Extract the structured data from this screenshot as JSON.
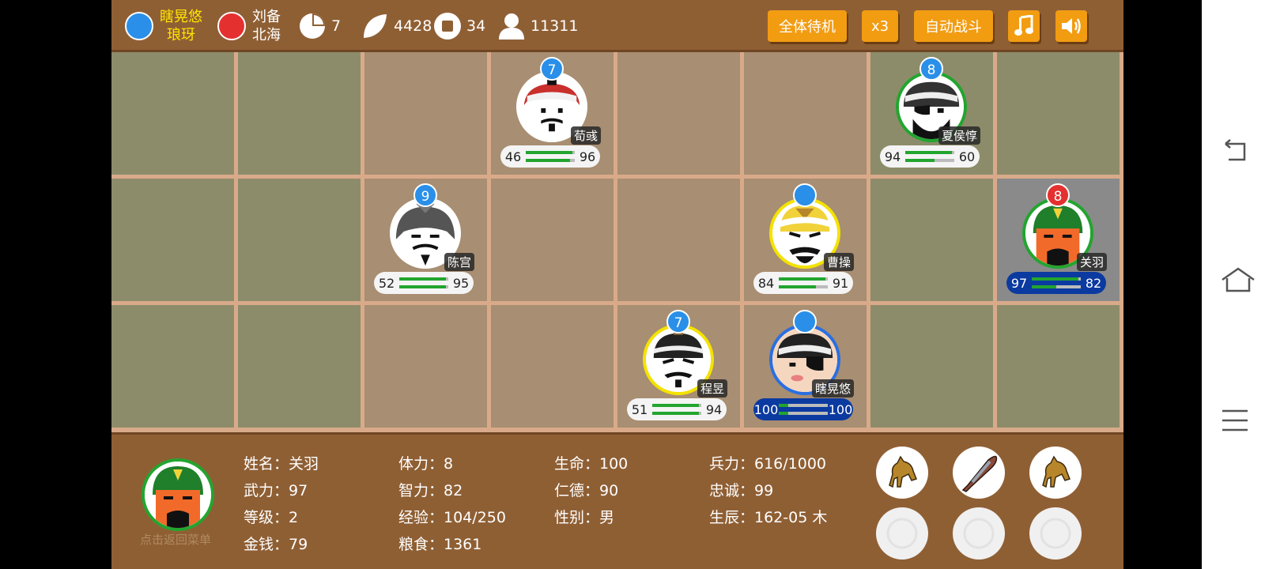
{
  "topbar": {
    "player_faction": {
      "line1": "瞎晃悠",
      "line2": "琅玡",
      "color": "#2a8fe8"
    },
    "enemy_faction": {
      "line1": "刘备",
      "line2": "北海",
      "color": "#e53030"
    },
    "stats": [
      {
        "icon": "pie-chart-icon",
        "value": "7"
      },
      {
        "icon": "leaf-icon",
        "value": "4428"
      },
      {
        "icon": "coin-icon",
        "value": "34"
      },
      {
        "icon": "person-icon",
        "value": "11311"
      }
    ],
    "buttons": {
      "standby": "全体待机",
      "speed": "x3",
      "auto": "自动战斗"
    },
    "music_icon": "music-note-icon",
    "sound_icon": "speaker-icon"
  },
  "units": [
    {
      "name": "荀彧",
      "level": "7",
      "left": "46",
      "right": "96",
      "ring": "#ffffff",
      "badge": "blue",
      "bar": "white",
      "hp": 0.95,
      "mp": 0.9
    },
    {
      "name": "夏侯惇",
      "level": "8",
      "left": "94",
      "right": "60",
      "ring": "#22a52f",
      "badge": "blue",
      "bar": "white",
      "hp": 0.95,
      "mp": 0.6
    },
    {
      "name": "陈宫",
      "level": "9",
      "left": "52",
      "right": "95",
      "ring": "#ffffff",
      "badge": "blue",
      "bar": "white",
      "hp": 0.95,
      "mp": 0.95
    },
    {
      "name": "曹操",
      "level": "",
      "left": "84",
      "right": "91",
      "ring": "#f4e200",
      "badge": "blue",
      "bar": "white",
      "hp": 0.95,
      "mp": 0.75
    },
    {
      "name": "关羽",
      "level": "8",
      "left": "97",
      "right": "82",
      "ring": "#22a52f",
      "badge": "red",
      "bar": "blue",
      "hp": 0.95,
      "mp": 0.5
    },
    {
      "name": "程昱",
      "level": "7",
      "left": "51",
      "right": "94",
      "ring": "#f4e200",
      "badge": "blue",
      "bar": "white",
      "hp": 0.95,
      "mp": 0.95
    },
    {
      "name": "瞎晃悠",
      "level": "",
      "left": "100",
      "right": "100",
      "ring": "#2a6fe0",
      "badge": "blue",
      "bar": "blue",
      "hp": 0.2,
      "mp": 0.2
    }
  ],
  "info": {
    "col1": [
      "姓名：关羽",
      "武力：97",
      "等级：2",
      "金钱：79"
    ],
    "col2": [
      "体力：8",
      "智力：82",
      "经验：104/250",
      "粮食：1361"
    ],
    "col3": [
      "生命：100",
      "仁德：90",
      "性别：男"
    ],
    "col4": [
      "兵力：616/1000",
      "忠诚：99",
      "生辰：162-05 木"
    ],
    "menu_hint": "点击返回菜单",
    "items": [
      "horse-icon",
      "sword-icon",
      "horse-icon",
      "empty-slot-icon",
      "empty-slot-icon",
      "empty-slot-icon"
    ]
  },
  "nav": [
    "back-icon",
    "home-icon",
    "menu-icon"
  ]
}
